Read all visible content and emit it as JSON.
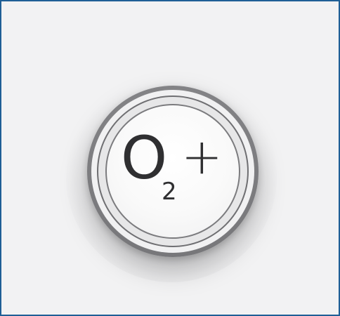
{
  "button": {
    "label_main": "O",
    "label_sub": "2",
    "label_suffix": "+"
  },
  "colors": {
    "frame_border": "#1f5f96",
    "background": "#f2f2f3",
    "button_ring": "#7a7a7d",
    "button_face": "#ffffff",
    "label": "#2f2f31"
  }
}
